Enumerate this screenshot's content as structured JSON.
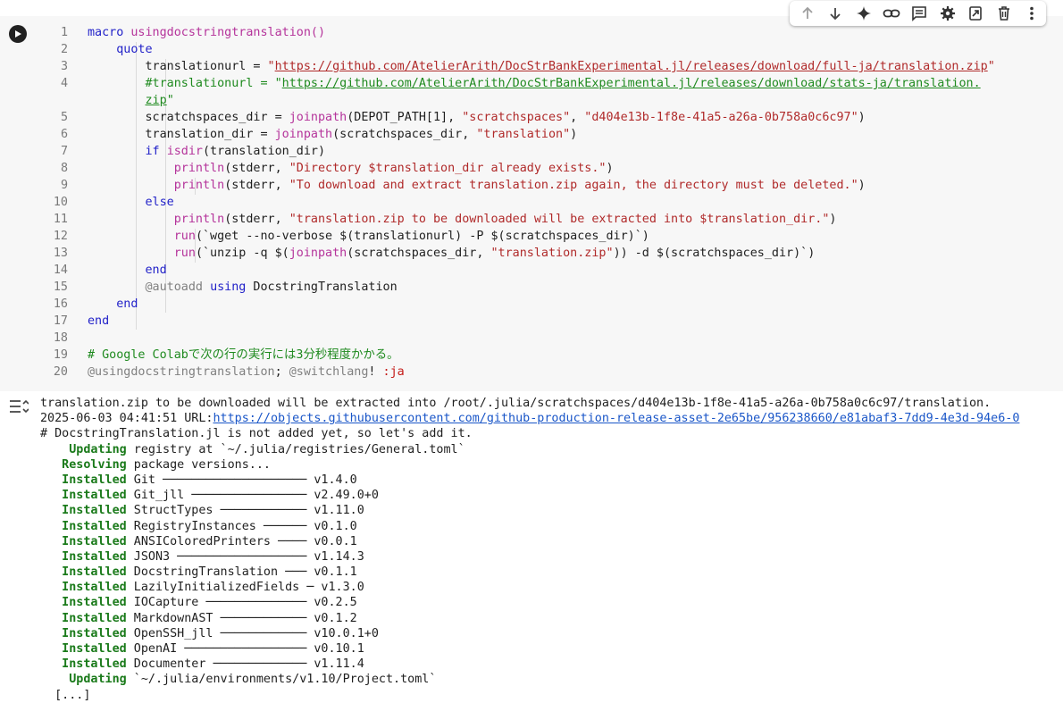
{
  "toolbar": {
    "icons": [
      "arrow-up-icon",
      "arrow-down-icon",
      "sparkle-icon",
      "link-icon",
      "comment-icon",
      "gear-icon",
      "mirror-cell-icon",
      "trash-icon",
      "more-vert-icon"
    ]
  },
  "code_lines": [
    {
      "n": "1",
      "parts": [
        [
          "macro ",
          "kw"
        ],
        [
          "usingdocstringtranslation()",
          "fn"
        ]
      ]
    },
    {
      "n": "2",
      "parts": [
        [
          "    quote",
          "kw"
        ]
      ]
    },
    {
      "n": "3",
      "parts": [
        [
          "        translationurl = ",
          ""
        ],
        [
          "\"",
          "str"
        ],
        [
          "https://github.com/AtelierArith/DocStrBankExperimental.jl/releases/download/full-ja/translation.zip",
          "str url"
        ],
        [
          "\"",
          "str"
        ]
      ]
    },
    {
      "n": "4",
      "parts": [
        [
          "        #translationurl = \"",
          "cm"
        ],
        [
          "https://github.com/AtelierArith/DocStrBankExperimental.jl/releases/download/stats-ja/translation.",
          "cm url"
        ]
      ]
    },
    {
      "n": "",
      "parts": [
        [
          "        ",
          ""
        ],
        [
          "zip",
          "cm url"
        ],
        [
          "\"",
          "cm"
        ]
      ]
    },
    {
      "n": "5",
      "parts": [
        [
          "        scratchspaces_dir = ",
          ""
        ],
        [
          "joinpath",
          "fn"
        ],
        [
          "(DEPOT_PATH[1], ",
          ""
        ],
        [
          "\"scratchspaces\"",
          "str"
        ],
        [
          ", ",
          ""
        ],
        [
          "\"d404e13b-1f8e-41a5-a26a-0b758a0c6c97\"",
          "str"
        ],
        [
          ")",
          ""
        ]
      ]
    },
    {
      "n": "6",
      "parts": [
        [
          "        translation_dir = ",
          ""
        ],
        [
          "joinpath",
          "fn"
        ],
        [
          "(scratchspaces_dir, ",
          ""
        ],
        [
          "\"translation\"",
          "str"
        ],
        [
          ")",
          ""
        ]
      ]
    },
    {
      "n": "7",
      "parts": [
        [
          "        ",
          ""
        ],
        [
          "if ",
          "kw"
        ],
        [
          "isdir",
          "fn"
        ],
        [
          "(translation_dir)",
          ""
        ]
      ]
    },
    {
      "n": "8",
      "parts": [
        [
          "            ",
          ""
        ],
        [
          "println",
          "fn"
        ],
        [
          "(stderr, ",
          ""
        ],
        [
          "\"Directory $translation_dir already exists.\"",
          "str"
        ],
        [
          ")",
          ""
        ]
      ]
    },
    {
      "n": "9",
      "parts": [
        [
          "            ",
          ""
        ],
        [
          "println",
          "fn"
        ],
        [
          "(stderr, ",
          ""
        ],
        [
          "\"To download and extract translation.zip again, the directory must be deleted.\"",
          "str"
        ],
        [
          ")",
          ""
        ]
      ]
    },
    {
      "n": "10",
      "parts": [
        [
          "        ",
          ""
        ],
        [
          "else",
          "kw"
        ]
      ]
    },
    {
      "n": "11",
      "parts": [
        [
          "            ",
          ""
        ],
        [
          "println",
          "fn"
        ],
        [
          "(stderr, ",
          ""
        ],
        [
          "\"translation.zip to be downloaded will be extracted into $translation_dir.\"",
          "str"
        ],
        [
          ")",
          ""
        ]
      ]
    },
    {
      "n": "12",
      "parts": [
        [
          "            ",
          ""
        ],
        [
          "run",
          "fn"
        ],
        [
          "(`wget --no-verbose $(translationurl) -P $(scratchspaces_dir)`)",
          ""
        ]
      ]
    },
    {
      "n": "13",
      "parts": [
        [
          "            ",
          ""
        ],
        [
          "run",
          "fn"
        ],
        [
          "(`unzip -q $(",
          ""
        ],
        [
          "joinpath",
          "fn"
        ],
        [
          "(scratchspaces_dir, ",
          ""
        ],
        [
          "\"translation.zip\"",
          "str"
        ],
        [
          ")) -d $(scratchspaces_dir)`)",
          ""
        ]
      ]
    },
    {
      "n": "14",
      "parts": [
        [
          "        ",
          ""
        ],
        [
          "end",
          "kw"
        ]
      ]
    },
    {
      "n": "15",
      "parts": [
        [
          "        ",
          ""
        ],
        [
          "@autoadd",
          "mac"
        ],
        [
          " ",
          ""
        ],
        [
          "using",
          "kw"
        ],
        [
          " DocstringTranslation",
          ""
        ]
      ]
    },
    {
      "n": "16",
      "parts": [
        [
          "    ",
          ""
        ],
        [
          "end",
          "kw"
        ]
      ]
    },
    {
      "n": "17",
      "parts": [
        [
          "end",
          "kw"
        ]
      ]
    },
    {
      "n": "18",
      "parts": []
    },
    {
      "n": "19",
      "parts": [
        [
          "# Google Colabで次の行の実行には3分秒程度かかる。",
          "cm"
        ]
      ]
    },
    {
      "n": "20",
      "parts": [
        [
          "@usingdocstringtranslation",
          "mac"
        ],
        [
          "; ",
          ""
        ],
        [
          "@switchlang",
          "mac"
        ],
        [
          "! ",
          ""
        ],
        [
          ":ja",
          "sym"
        ]
      ]
    }
  ],
  "output_lines": [
    [
      [
        "translation.zip to be downloaded will be extracted into /root/.julia/scratchspaces/d404e13b-1f8e-41a5-a26a-0b758a0c6c97/translation.",
        ""
      ]
    ],
    [
      [
        "2025-06-03 04:41:51 URL:",
        ""
      ],
      [
        "https://objects.githubusercontent.com/github-production-release-asset-2e65be/956238660/e81abaf3-7dd9-4e3d-94e6-0",
        "link"
      ]
    ],
    [
      [
        "# DocstringTranslation.jl is not added yet, so let's add it.",
        ""
      ]
    ],
    [
      [
        "    Updating",
        "b"
      ],
      [
        " registry at `~/.julia/registries/General.toml`",
        ""
      ]
    ],
    [
      [
        "   Resolving",
        "b"
      ],
      [
        " package versions...",
        ""
      ]
    ],
    [
      [
        "   Installed",
        "b"
      ],
      [
        " Git ──────────────────── v1.4.0",
        ""
      ]
    ],
    [
      [
        "   Installed",
        "b"
      ],
      [
        " Git_jll ──────────────── v2.49.0+0",
        ""
      ]
    ],
    [
      [
        "   Installed",
        "b"
      ],
      [
        " StructTypes ──────────── v1.11.0",
        ""
      ]
    ],
    [
      [
        "   Installed",
        "b"
      ],
      [
        " RegistryInstances ────── v0.1.0",
        ""
      ]
    ],
    [
      [
        "   Installed",
        "b"
      ],
      [
        " ANSIColoredPrinters ──── v0.0.1",
        ""
      ]
    ],
    [
      [
        "   Installed",
        "b"
      ],
      [
        " JSON3 ────────────────── v1.14.3",
        ""
      ]
    ],
    [
      [
        "   Installed",
        "b"
      ],
      [
        " DocstringTranslation ─── v0.1.1",
        ""
      ]
    ],
    [
      [
        "   Installed",
        "b"
      ],
      [
        " LazilyInitializedFields ─ v1.3.0",
        ""
      ]
    ],
    [
      [
        "   Installed",
        "b"
      ],
      [
        " IOCapture ────────────── v0.2.5",
        ""
      ]
    ],
    [
      [
        "   Installed",
        "b"
      ],
      [
        " MarkdownAST ──────────── v0.1.2",
        ""
      ]
    ],
    [
      [
        "   Installed",
        "b"
      ],
      [
        " OpenSSH_jll ──────────── v10.0.1+0",
        ""
      ]
    ],
    [
      [
        "   Installed",
        "b"
      ],
      [
        " OpenAI ───────────────── v0.10.1",
        ""
      ]
    ],
    [
      [
        "   Installed",
        "b"
      ],
      [
        " Documenter ───────────── v1.11.4",
        ""
      ]
    ],
    [
      [
        "    Updating",
        "b"
      ],
      [
        " `~/.julia/environments/v1.10/Project.toml`",
        ""
      ]
    ],
    [
      [
        "  [...]",
        ""
      ]
    ]
  ]
}
